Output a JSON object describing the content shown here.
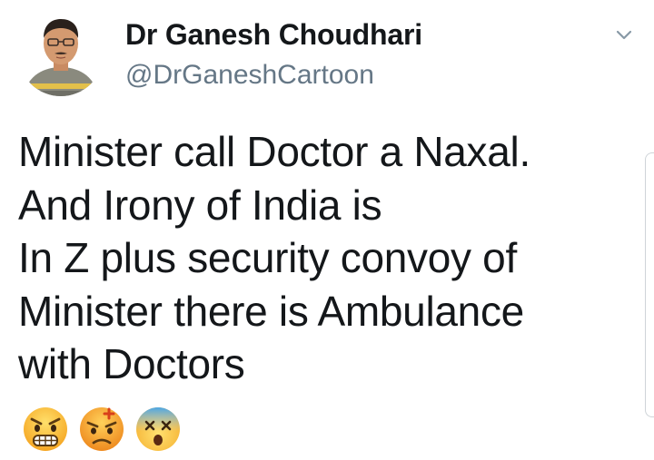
{
  "tweet": {
    "author": {
      "name": "Dr Ganesh Choudhari",
      "handle": "@DrGaneshCartoon"
    },
    "body_lines": [
      "Minister call Doctor a Naxal.",
      "And Irony of India is",
      "In Z plus security convoy of",
      "Minister there is Ambulance",
      "with Doctors"
    ],
    "emojis": [
      {
        "icon": "angry-face-grimacing-icon",
        "description": "angry face"
      },
      {
        "icon": "angry-face-with-vein-icon",
        "description": "angry face with anger symbol"
      },
      {
        "icon": "dizzy-face-icon",
        "description": "face with crossed-out eyes"
      }
    ]
  },
  "colors": {
    "text": "#14171a",
    "secondary_text": "#657786",
    "chevron": "#8899a6",
    "emoji_yellow": "#ffc83d",
    "emoji_orange": "#f59a23",
    "emoji_blue": "#5bb3e8"
  }
}
